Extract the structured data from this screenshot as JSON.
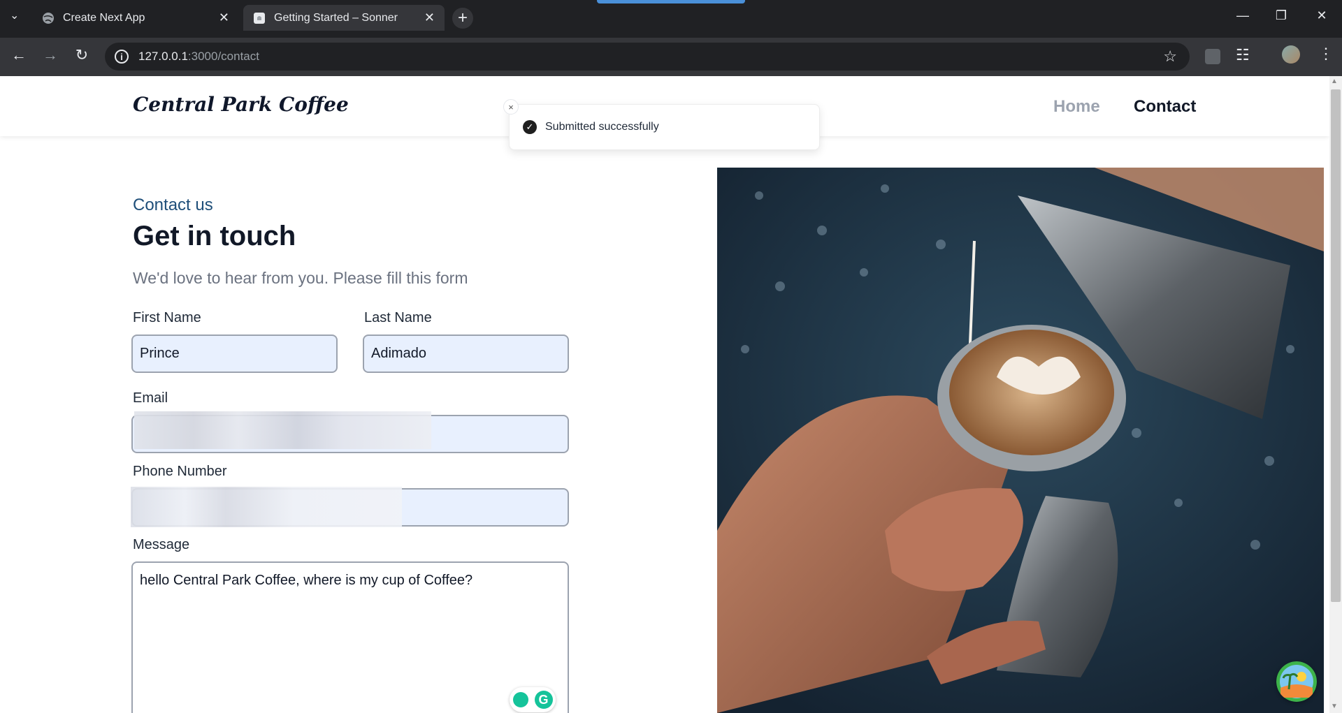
{
  "browser": {
    "tabs": [
      {
        "title": "Create Next App",
        "active": false
      },
      {
        "title": "Getting Started – Sonner",
        "active": true
      }
    ],
    "url_host": "127.0.0.1",
    "url_rest": ":3000/contact"
  },
  "site": {
    "logo": "Central Park Coffee",
    "nav": {
      "home": "Home",
      "contact": "Contact"
    }
  },
  "form": {
    "eyebrow": "Contact us",
    "heading": "Get in touch",
    "subheading": "We'd love to hear from you. Please fill this form",
    "first_name_label": "First Name",
    "first_name_value": "Prince",
    "last_name_label": "Last Name",
    "last_name_value": "Adimado",
    "email_label": "Email",
    "phone_label": "Phone Number",
    "message_label": "Message",
    "message_value": "hello Central Park Coffee, where is my cup of Coffee?"
  },
  "toast": {
    "message": "Submitted successfully",
    "close_glyph": "×"
  },
  "colors": {
    "accent": "#1e4e79",
    "input_bg": "#e8f0fe",
    "nav_inactive": "#9ca3af"
  }
}
